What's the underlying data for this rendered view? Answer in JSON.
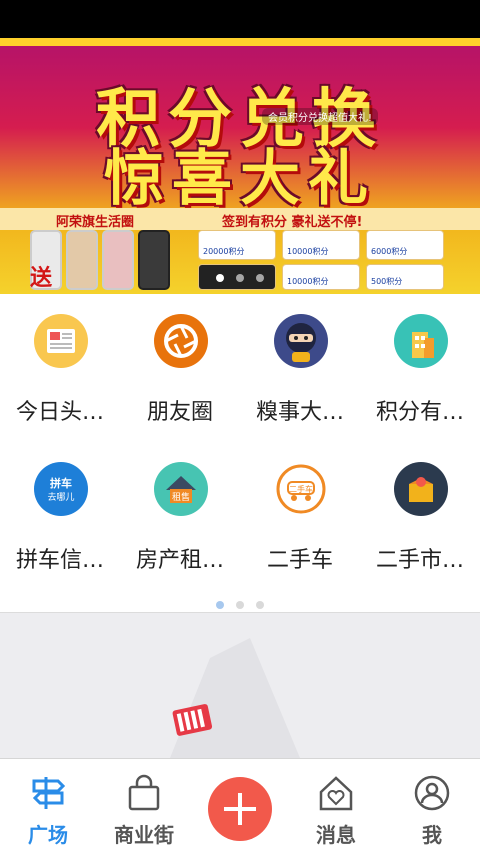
{
  "banner": {
    "title_line1": "积分兑换",
    "title_line2": "惊喜大礼",
    "caption": "会员积分兑换超值大礼!",
    "slogan_left": "阿荣旗生活圈",
    "slogan_right": "签到有积分 豪礼送不停!",
    "badge": "送",
    "prizes": [
      "20000积分",
      "10000积分",
      "6000积分",
      "10000积分",
      "500积分"
    ],
    "slides_total": 3,
    "slides_active": 1
  },
  "grid": {
    "items": [
      {
        "label": "今日头…",
        "icon": "news-icon",
        "color": "#f9c74f"
      },
      {
        "label": "朋友圈",
        "icon": "camera-shutter-icon",
        "color": "#e8730c"
      },
      {
        "label": "糗事大…",
        "icon": "ninja-icon",
        "color": "#3d4a8a"
      },
      {
        "label": "积分有…",
        "icon": "building-icon",
        "color": "#38c2b6"
      },
      {
        "label": "拼车信…",
        "icon": "carpool-icon",
        "color": "#1e7fd8"
      },
      {
        "label": "房产租…",
        "icon": "house-rent-icon",
        "color": "#47c4b2"
      },
      {
        "label": "二手车",
        "icon": "used-car-icon",
        "color": "#f08a24"
      },
      {
        "label": "二手市…",
        "icon": "secondhand-box-icon",
        "color": "#2b3a4e"
      }
    ],
    "carpool_icon_text": "拼车\n去哪儿",
    "rent_icon_text": "租售",
    "used_car_icon_text": "二手车",
    "pages_total": 3,
    "pages_active": 1
  },
  "bottom_nav": {
    "items": [
      {
        "label": "广场",
        "icon": "signpost-icon",
        "active": true
      },
      {
        "label": "商业街",
        "icon": "shopping-bag-icon",
        "active": false
      },
      {
        "label": "",
        "icon": "plus-icon",
        "active": false
      },
      {
        "label": "消息",
        "icon": "home-heart-icon",
        "active": false
      },
      {
        "label": "我",
        "icon": "user-icon",
        "active": false
      }
    ]
  },
  "colors": {
    "accent": "#2a8ce8",
    "add_button": "#f2594b"
  }
}
